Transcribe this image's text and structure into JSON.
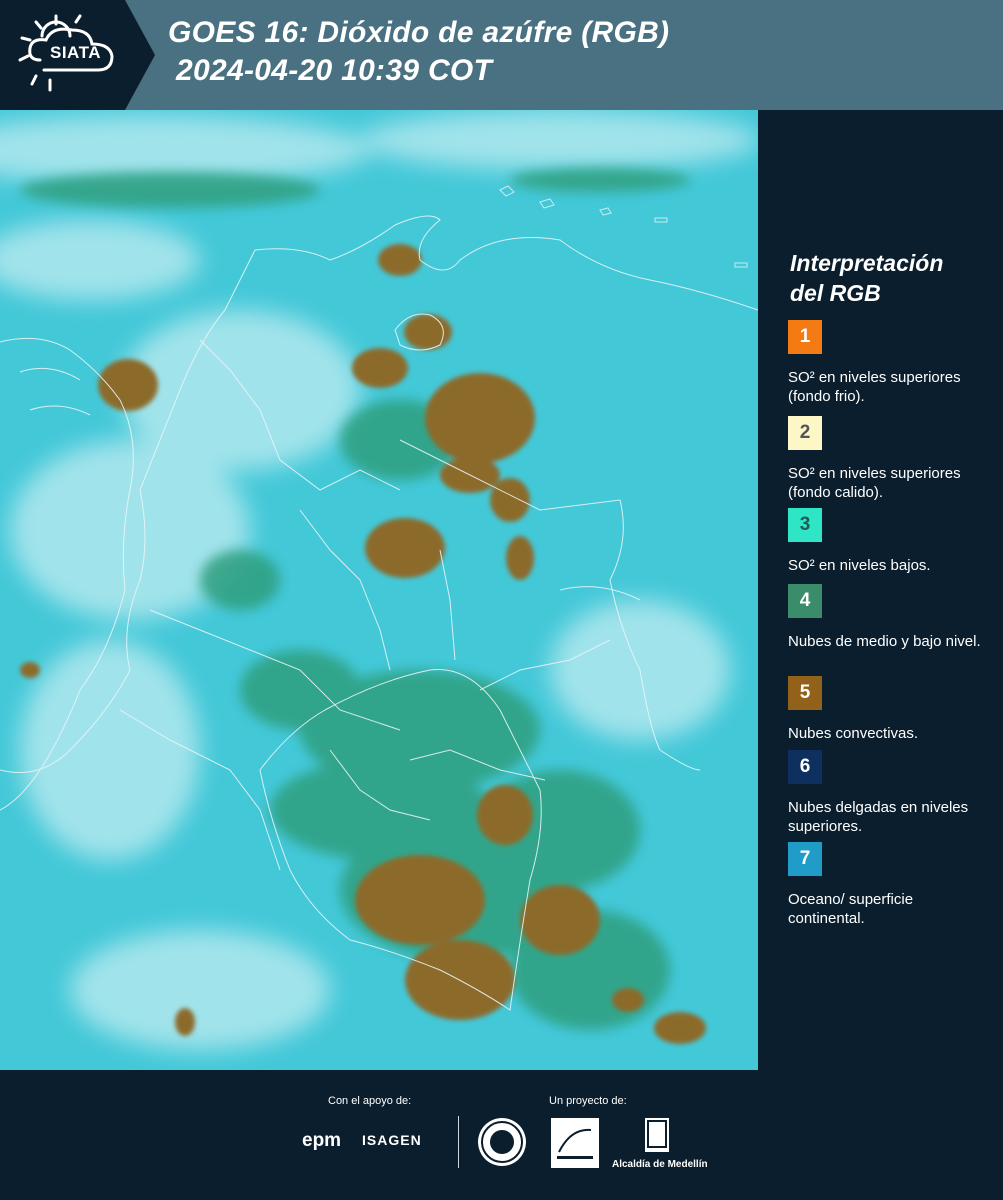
{
  "header": {
    "logo_text": "SIATA",
    "title_line1": "GOES 16: Dióxido de azúfre (RGB)",
    "title_line2": "2024-04-20 10:39 COT"
  },
  "legend": {
    "title_line1": "Interpretación",
    "title_line2": "del RGB",
    "items": [
      {
        "num": "1",
        "color": "#f47b14",
        "num_color": "#ffffff",
        "text": "SO² en niveles superiores (fondo frio)."
      },
      {
        "num": "2",
        "color": "#fdf6c6",
        "num_color": "#555555",
        "text": "SO² en niveles superiores (fondo calido)."
      },
      {
        "num": "3",
        "color": "#2ee6c6",
        "num_color": "#1d5b57",
        "text": "SO² en niveles bajos."
      },
      {
        "num": "4",
        "color": "#3b8c6a",
        "num_color": "#ffffff",
        "text": "Nubes de medio y bajo nivel."
      },
      {
        "num": "5",
        "color": "#93621a",
        "num_color": "#ffffff",
        "text": "Nubes convectivas."
      },
      {
        "num": "6",
        "color": "#0e3061",
        "num_color": "#ffffff",
        "text": "Nubes delgadas en niveles superiores."
      },
      {
        "num": "7",
        "color": "#1f9cc8",
        "num_color": "#ffffff",
        "text": "Oceano/ superficie continental."
      }
    ]
  },
  "footer": {
    "support_label": "Con el apoyo de:",
    "project_label": "Un proyecto de:",
    "sponsor_1": "epm",
    "sponsor_2": "ISAGEN",
    "partner_label": "Alcaldía de Medellín"
  }
}
